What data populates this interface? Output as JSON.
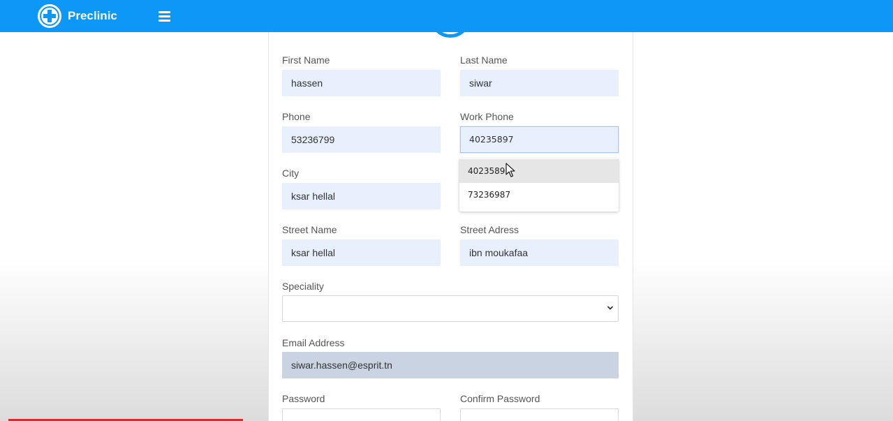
{
  "app": {
    "brand": "Preclinic"
  },
  "form": {
    "first_name": {
      "label": "First Name",
      "value": "hassen"
    },
    "last_name": {
      "label": "Last Name",
      "value": "siwar"
    },
    "phone": {
      "label": "Phone",
      "value": "53236799"
    },
    "work_phone": {
      "label": "Work Phone",
      "value": "40235897"
    },
    "city": {
      "label": "City",
      "value": "ksar hellal"
    },
    "street_name": {
      "label": "Street Name",
      "value": "ksar hellal"
    },
    "street_address": {
      "label": "Street Adress",
      "value": "ibn moukafaa"
    },
    "speciality": {
      "label": "Speciality",
      "value": ""
    },
    "email": {
      "label": "Email Address",
      "value": "siwar.hassen@esprit.tn"
    },
    "password": {
      "label": "Password",
      "value": ""
    },
    "confirm_password": {
      "label": "Confirm Password",
      "value": ""
    }
  },
  "autocomplete": {
    "items": [
      "40235897",
      "73236987"
    ]
  },
  "colors": {
    "topbar": "#0d97f7",
    "autofill_bg": "#e8f0fe",
    "progress": "#e3262b"
  },
  "icons": {
    "logo": "plus-circle-icon",
    "menu": "hamburger-menu-icon",
    "select_arrow": "chevron-down-icon",
    "pointer": "mouse-cursor-icon"
  }
}
